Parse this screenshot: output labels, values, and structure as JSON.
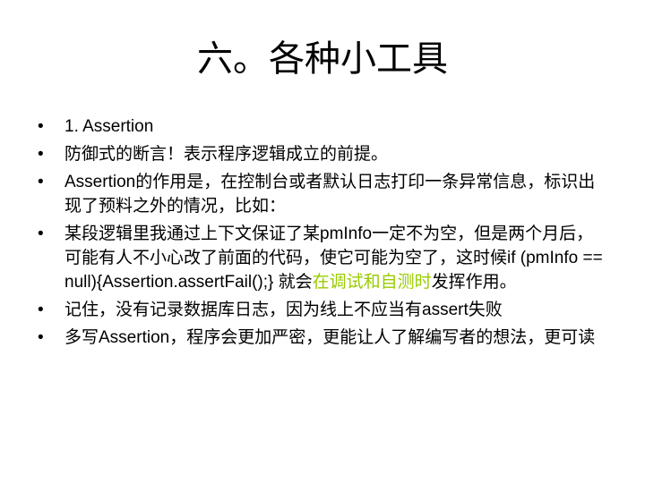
{
  "slide": {
    "title": "六。各种小工具",
    "bullet_symbol": "•",
    "highlight_color": "#99cc00",
    "bullets": [
      {
        "text": "1. Assertion"
      },
      {
        "text": "防御式的断言！表示程序逻辑成立的前提。"
      },
      {
        "text": "Assertion的作用是，在控制台或者默认日志打印一条异常信息，标识出现了预料之外的情况，比如："
      },
      {
        "text_before": "某段逻辑里我通过上下文保证了某pmInfo一定不为空，但是两个月后，可能有人不小心改了前面的代码，使它可能为空了，这时候if (pmInfo == null){Assertion.assertFail();} 就会",
        "highlight": "在调试和自测时",
        "text_after": "发挥作用。"
      },
      {
        "text": "记住，没有记录数据库日志，因为线上不应当有assert失败"
      },
      {
        "text": "多写Assertion，程序会更加严密，更能让人了解编写者的想法，更可读"
      }
    ]
  }
}
